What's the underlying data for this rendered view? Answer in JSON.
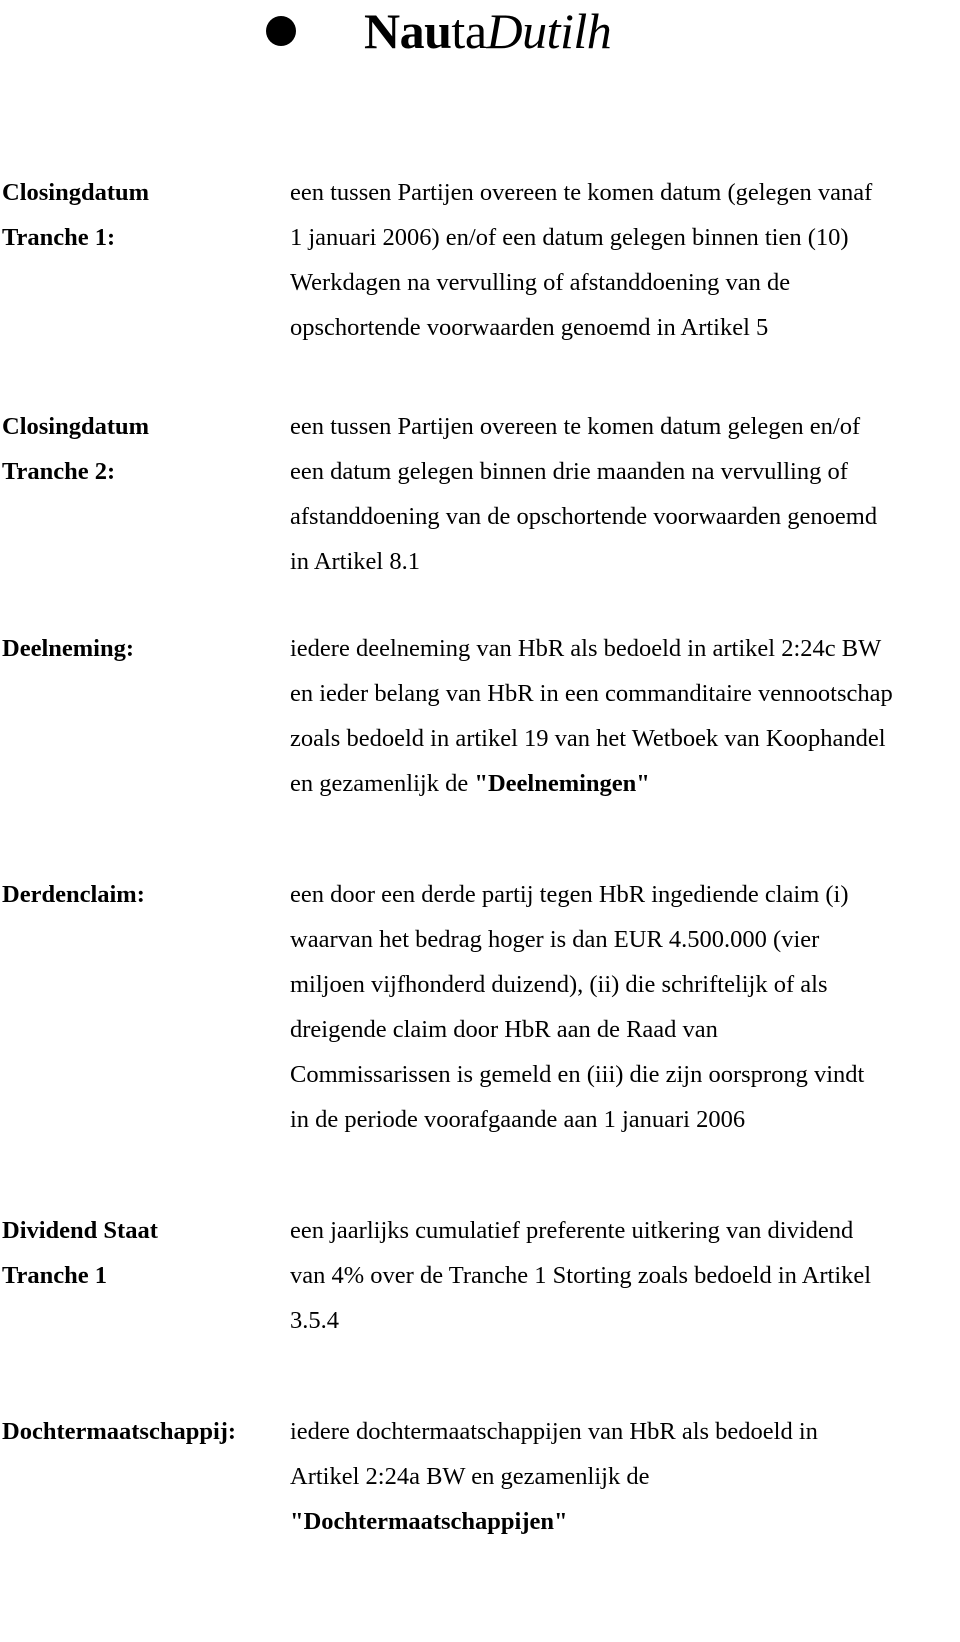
{
  "letterhead": {
    "bullet_icon": "filled-circle-bullet",
    "logo": {
      "part_bold": "Nau",
      "part_regular": "ta",
      "part_italic": "Dutilh",
      "full_text": "NautaDutilh"
    }
  },
  "definitions": [
    {
      "term_lines": [
        "Closingdatum",
        "Tranche 1:"
      ],
      "body_lines": [
        "een tussen Partijen overeen te komen datum (gelegen vanaf",
        "1 januari 2006) en/of een datum gelegen binnen tien (10)",
        "Werkdagen na vervulling of afstanddoening van de",
        "opschortende voorwaarden genoemd in Artikel 5"
      ]
    },
    {
      "term_lines": [
        "Closingdatum",
        "Tranche 2:"
      ],
      "body_lines": [
        "een tussen Partijen overeen te komen datum gelegen en/of",
        "een datum gelegen binnen drie maanden na vervulling of",
        "afstanddoening van de opschortende voorwaarden genoemd",
        "in Artikel 8.1"
      ]
    },
    {
      "term_lines": [
        "Deelneming:"
      ],
      "body_lines": [
        "iedere deelneming van HbR als bedoeld in artikel 2:24c BW",
        "en ieder belang van HbR in een commanditaire vennootschap",
        "zoals bedoeld in artikel 19 van het Wetboek van Koophandel"
      ],
      "body_last_line_prefix": "en gezamenlijk de ",
      "body_last_line_bold": "\"Deelnemingen\""
    },
    {
      "term_lines": [
        "Derdenclaim:"
      ],
      "body_lines": [
        "een door een derde partij tegen HbR ingediende claim (i)",
        "waarvan het bedrag hoger is dan EUR 4.500.000 (vier",
        "miljoen vijfhonderd duizend), (ii) die schriftelijk of als",
        "dreigende claim door HbR aan de Raad van",
        "Commissarissen is gemeld en (iii) die zijn oorsprong vindt",
        "in de periode voorafgaande aan 1 januari 2006"
      ]
    },
    {
      "term_lines": [
        "Dividend Staat",
        "Tranche 1"
      ],
      "body_lines": [
        "een jaarlijks cumulatief preferente uitkering van dividend",
        "van 4% over de Tranche 1 Storting zoals bedoeld in Artikel",
        "3.5.4"
      ]
    },
    {
      "term_lines": [
        "Dochtermaatschappij:"
      ],
      "body_lines": [
        "iedere dochtermaatschappijen van HbR als bedoeld in",
        "Artikel 2:24a BW en gezamenlijk de"
      ],
      "body_last_line_bold": "\"Dochtermaatschappijen\""
    }
  ]
}
